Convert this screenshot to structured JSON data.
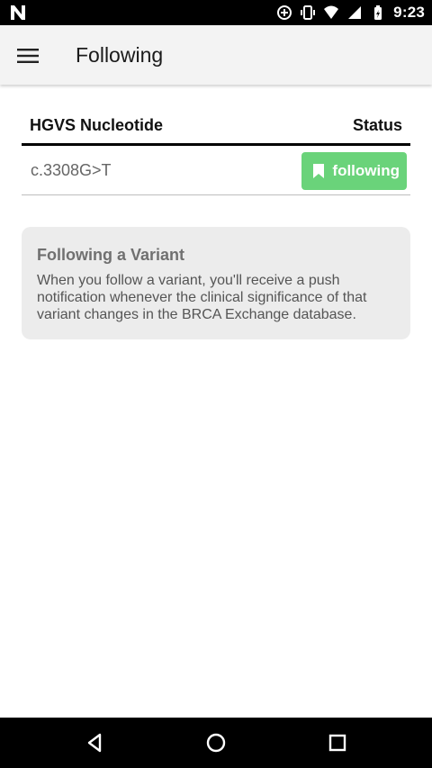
{
  "status_bar": {
    "time": "9:23",
    "left_icon": "notification-n-icon",
    "right_icons": [
      "data-saver-icon",
      "vibrate-icon",
      "wifi-icon",
      "signal-icon",
      "battery-icon"
    ]
  },
  "app_bar": {
    "title": "Following",
    "menu_icon": "hamburger-menu-icon"
  },
  "table": {
    "columns": [
      "HGVS Nucleotide",
      "Status"
    ],
    "rows": [
      {
        "nucleotide": "c.3308G>T",
        "status_label": "following",
        "status_icon": "bookmark-icon"
      }
    ]
  },
  "info_card": {
    "title": "Following a Variant",
    "text": "When you follow a variant, you'll receive a push notification whenever the clinical significance of that variant changes in the BRCA Exchange database."
  },
  "nav_bar": {
    "buttons": [
      "back-icon",
      "home-icon",
      "recents-icon"
    ]
  },
  "colors": {
    "status_bar_bg": "#000000",
    "app_bar_bg": "#f3f3f3",
    "accent_green": "#6ad37a",
    "info_card_bg": "#ececec"
  }
}
